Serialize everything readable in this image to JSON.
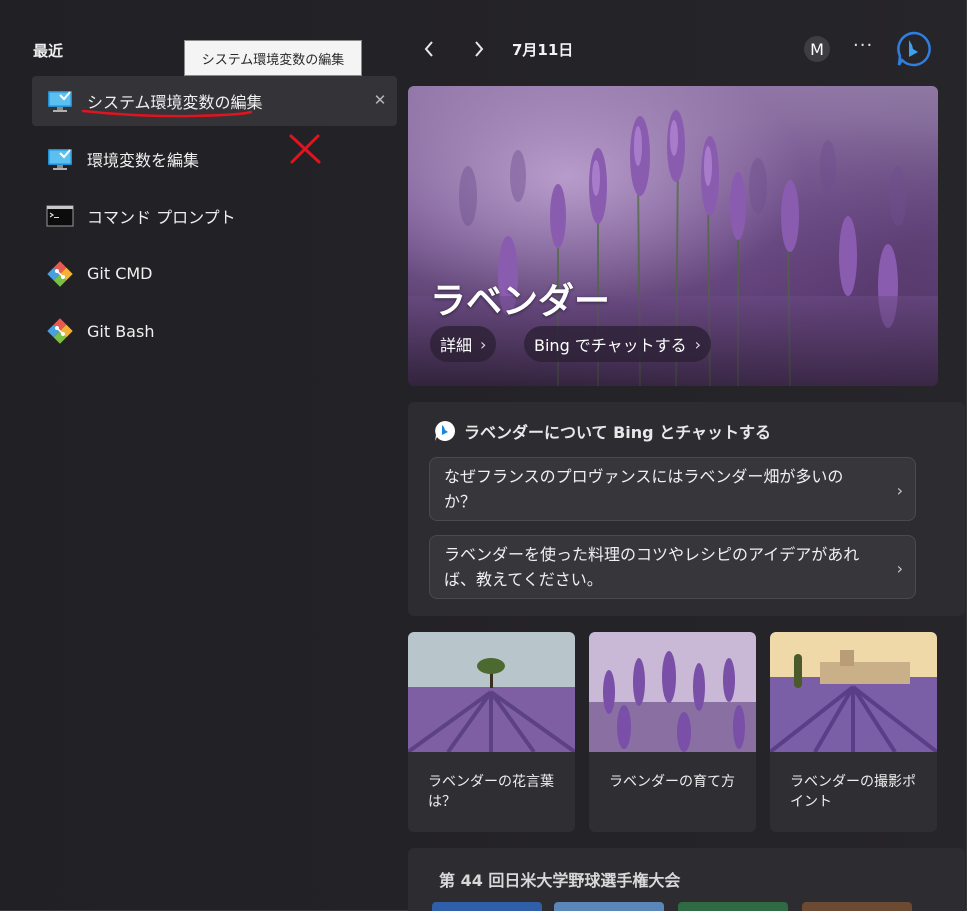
{
  "left_panel": {
    "section_title": "最近",
    "tooltip": "システム環境変数の編集",
    "items": [
      {
        "label": "システム環境変数の編集",
        "icon": "monitor-settings-icon",
        "selected": true,
        "remove_glyph": "✕"
      },
      {
        "label": "環境変数を編集",
        "icon": "monitor-settings-icon"
      },
      {
        "label": "コマンド プロンプト",
        "icon": "command-prompt-icon"
      },
      {
        "label": "Git CMD",
        "icon": "git-icon"
      },
      {
        "label": "Git Bash",
        "icon": "git-icon"
      }
    ]
  },
  "header": {
    "back_glyph": "‹",
    "forward_glyph": "›",
    "date": "7月11日",
    "avatar_initial": "M",
    "more_glyph": "···"
  },
  "hero": {
    "title": "ラベンダー",
    "details_button": "詳細",
    "chat_button": "Bing でチャットする",
    "chevron": "›"
  },
  "chat_card": {
    "title": "ラベンダーについて Bing とチャットする",
    "suggestions": [
      "なぜフランスのプロヴァンスにはラベンダー畑が多いのか？",
      "ラベンダーを使った料理のコツやレシピのアイデアがあれば、教えてください。"
    ],
    "chevron": "›"
  },
  "tiles": [
    {
      "caption": "ラベンダーの花言葉は？"
    },
    {
      "caption": "ラベンダーの育て方"
    },
    {
      "caption": "ラベンダーの撮影ポイント"
    }
  ],
  "next_card": {
    "title": "第 44 回日米大学野球選手権大会"
  },
  "colors": {
    "background": "#212125",
    "card": "#2c2c31",
    "accent_bing": "#1ba1e2",
    "annotation_red": "#e0141e"
  }
}
